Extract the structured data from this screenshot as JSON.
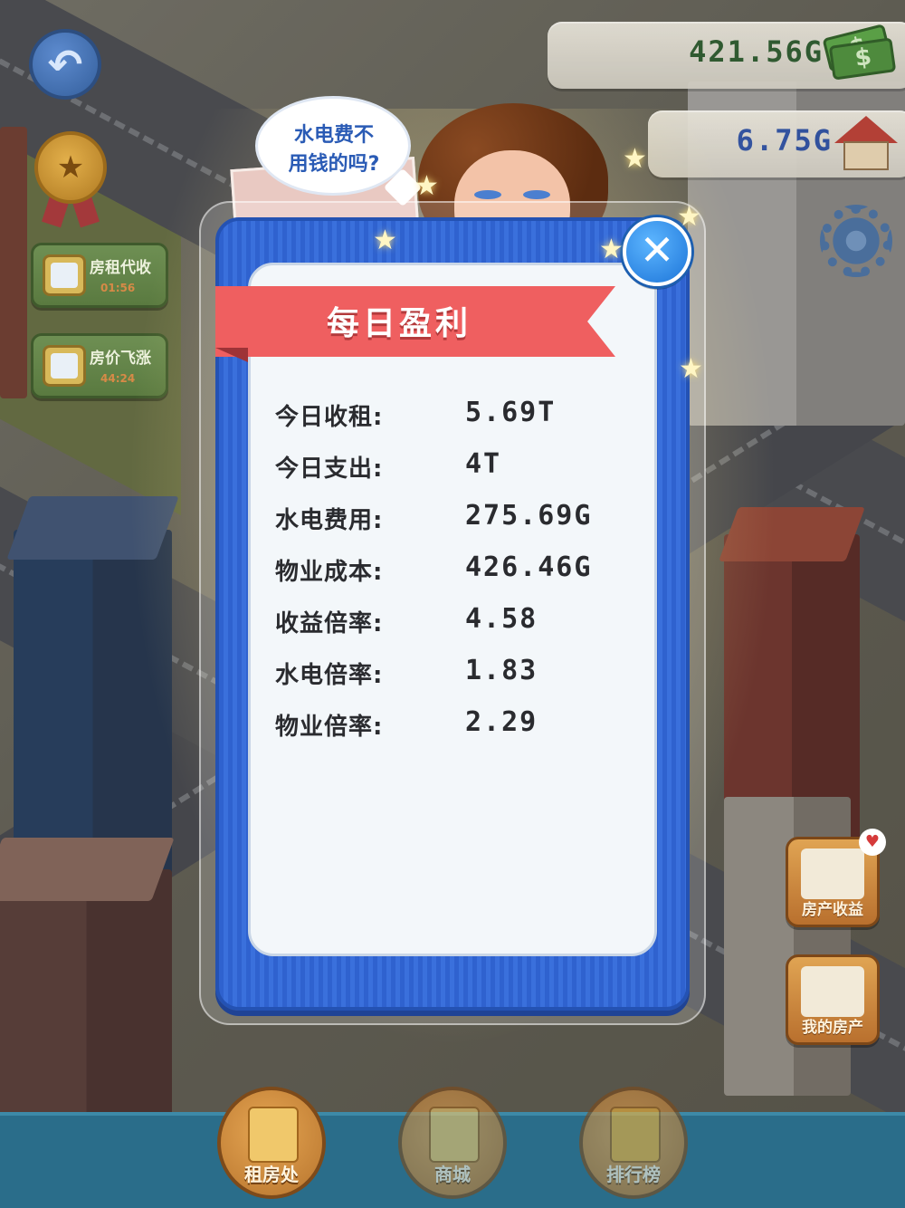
{
  "top_right": {
    "cash_value": "421.56G",
    "house_value": "6.75G"
  },
  "left_panel": {
    "rent_collect_label": "房租代收",
    "rent_collect_sub": "01:56",
    "price_surge_label": "房价飞涨",
    "price_surge_sub": "44:24"
  },
  "speech_bubble": {
    "line1": "水电费不",
    "line2": "用钱的吗?"
  },
  "modal": {
    "title": "每日盈利",
    "close_symbol": "✕",
    "rows": [
      {
        "label": "今日收租:",
        "value": "5.69T"
      },
      {
        "label": "今日支出:",
        "value": "4T"
      },
      {
        "label": "水电费用:",
        "value": "275.69G"
      },
      {
        "label": "物业成本:",
        "value": "426.46G"
      },
      {
        "label": "收益倍率:",
        "value": "4.58"
      },
      {
        "label": "水电倍率:",
        "value": "1.83"
      },
      {
        "label": "物业倍率:",
        "value": "2.29"
      }
    ]
  },
  "right_panel": {
    "property_income_label": "房产收益",
    "my_property_label": "我的房产"
  },
  "bottom_nav": {
    "rent_office_label": "租房处",
    "shop_label": "商城",
    "ranking_label": "排行榜"
  },
  "icons": {
    "back": "back-arrow-icon",
    "medal": "medal-icon",
    "cash": "cash-icon",
    "house": "house-icon",
    "settings": "gear-icon",
    "close": "close-icon"
  },
  "colors": {
    "modal_blue": "#2f62cf",
    "banner_red": "#ef5f60",
    "close_blue": "#1c74d8",
    "cash_green": "#2c5a2f",
    "house_blue": "#2b4ea0"
  }
}
